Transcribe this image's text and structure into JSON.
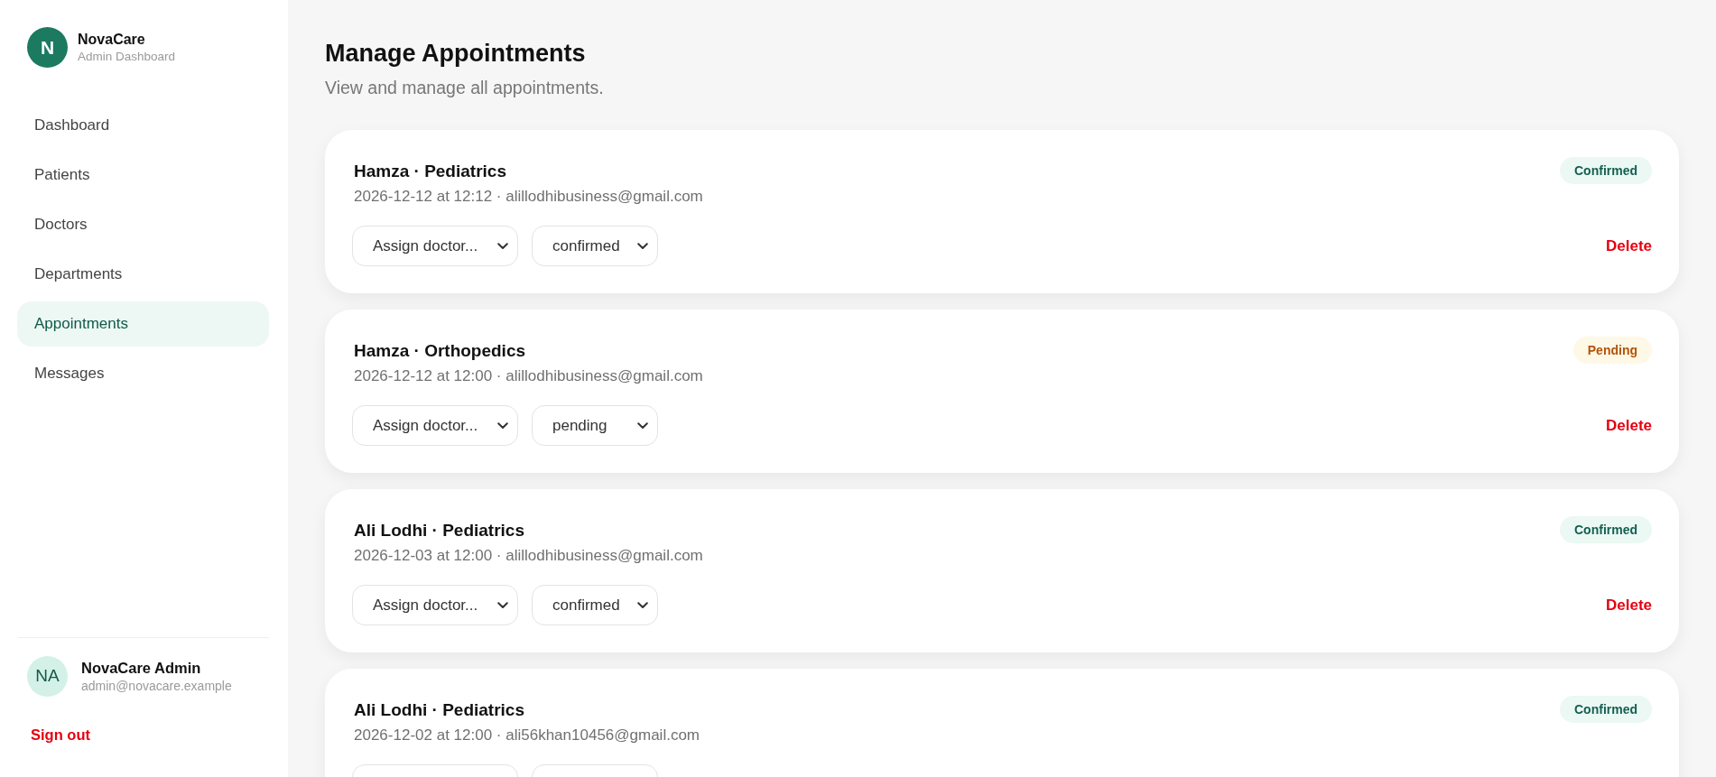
{
  "sidebar": {
    "brand": {
      "logo_letter": "N",
      "name": "NovaCare",
      "subtitle": "Admin Dashboard"
    },
    "items": [
      {
        "label": "Dashboard",
        "selected": false
      },
      {
        "label": "Patients",
        "selected": false
      },
      {
        "label": "Doctors",
        "selected": false
      },
      {
        "label": "Departments",
        "selected": false
      },
      {
        "label": "Appointments",
        "selected": true
      },
      {
        "label": "Messages",
        "selected": false
      }
    ],
    "user": {
      "initials": "NA",
      "name": "NovaCare Admin",
      "email": "admin@novacare.example"
    },
    "sign_out": "Sign out"
  },
  "page": {
    "title": "Manage Appointments",
    "subtitle": "View and manage all appointments."
  },
  "appointments": [
    {
      "title": "Hamza · Pediatrics",
      "details": "2026-12-12 at 12:12 · alillodhibusiness@gmail.com",
      "status_badge": {
        "label": "Confirmed",
        "kind": "confirmed"
      },
      "doctor_select": "Assign doctor...",
      "status_select": "confirmed",
      "delete": "Delete"
    },
    {
      "title": "Hamza · Orthopedics",
      "details": "2026-12-12 at 12:00 · alillodhibusiness@gmail.com",
      "status_badge": {
        "label": "Pending",
        "kind": "pending"
      },
      "doctor_select": "Assign doctor...",
      "status_select": "pending",
      "delete": "Delete"
    },
    {
      "title": "Ali Lodhi · Pediatrics",
      "details": "2026-12-03 at 12:00 · alillodhibusiness@gmail.com",
      "status_badge": {
        "label": "Confirmed",
        "kind": "confirmed"
      },
      "doctor_select": "Assign doctor...",
      "status_select": "confirmed",
      "delete": "Delete"
    },
    {
      "title": "Ali Lodhi · Pediatrics",
      "details": "2026-12-02 at 12:00 · ali56khan10456@gmail.com",
      "status_badge": {
        "label": "Confirmed",
        "kind": "confirmed"
      }
    }
  ]
}
